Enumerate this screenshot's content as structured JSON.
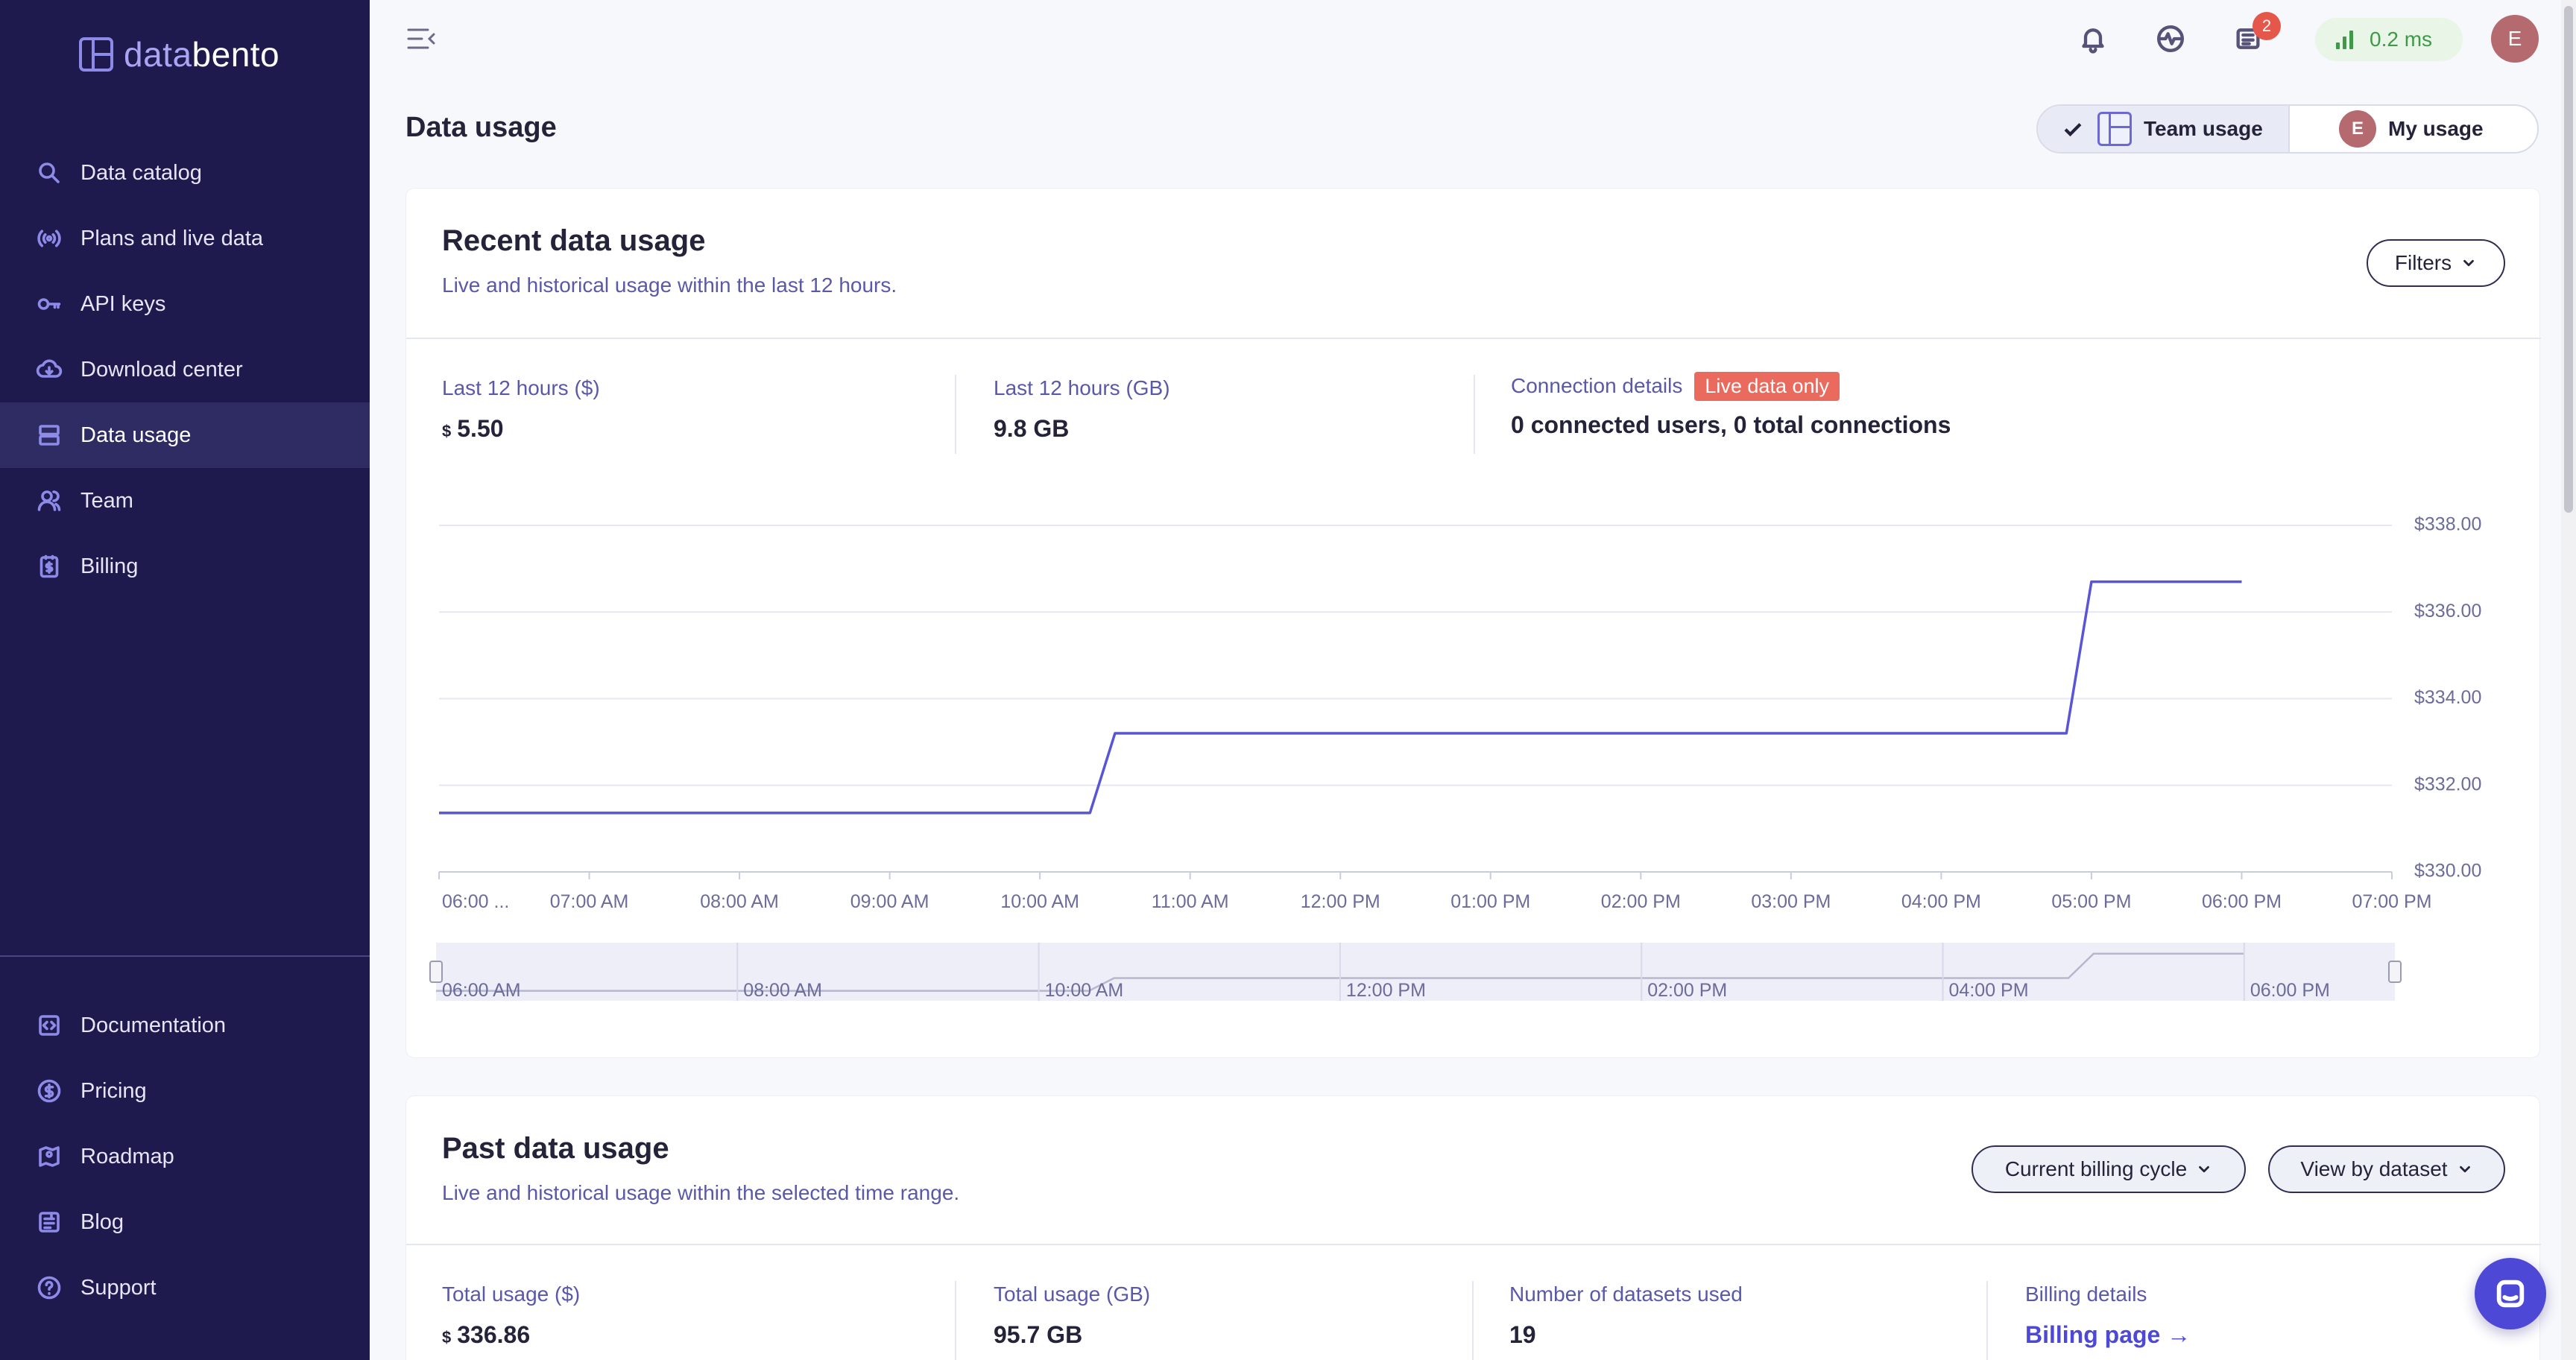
{
  "sidebar": {
    "logo": {
      "part1": "data",
      "part2": "bento"
    },
    "items": [
      {
        "label": "Data catalog",
        "icon": "search-icon"
      },
      {
        "label": "Plans and live data",
        "icon": "broadcast-icon"
      },
      {
        "label": "API keys",
        "icon": "key-icon"
      },
      {
        "label": "Download center",
        "icon": "cloud-download-icon"
      },
      {
        "label": "Data usage",
        "icon": "database-icon",
        "active": true
      },
      {
        "label": "Team",
        "icon": "team-icon"
      },
      {
        "label": "Billing",
        "icon": "receipt-dollar-icon"
      }
    ],
    "bottom_items": [
      {
        "label": "Documentation",
        "icon": "code-doc-icon"
      },
      {
        "label": "Pricing",
        "icon": "dollar-circle-icon"
      },
      {
        "label": "Roadmap",
        "icon": "map-icon"
      },
      {
        "label": "Blog",
        "icon": "blog-icon"
      },
      {
        "label": "Support",
        "icon": "help-circle-icon"
      }
    ]
  },
  "topbar": {
    "notifications_badge": "2",
    "latency": "0.2 ms",
    "avatar_initial": "E"
  },
  "header": {
    "title": "Data usage",
    "toggle": {
      "team_label": "Team usage",
      "my_label": "My usage",
      "selected": "Team usage",
      "my_avatar": "E"
    }
  },
  "recent": {
    "title": "Recent data usage",
    "subtitle": "Live and historical usage within the last 12 hours.",
    "filters_label": "Filters",
    "stats": {
      "cost_label": "Last 12 hours ($)",
      "cost_currency": "$",
      "cost_value": "5.50",
      "gb_label": "Last 12 hours (GB)",
      "gb_value": "9.8 GB",
      "conn_label": "Connection details",
      "conn_badge": "Live data only",
      "conn_value": "0 connected users, 0 total connections"
    }
  },
  "chart_data": {
    "type": "line",
    "title": "",
    "x_tick_labels": [
      "06:00 ...",
      "07:00 AM",
      "08:00 AM",
      "09:00 AM",
      "10:00 AM",
      "11:00 AM",
      "12:00 PM",
      "01:00 PM",
      "02:00 PM",
      "03:00 PM",
      "04:00 PM",
      "05:00 PM",
      "06:00 PM",
      "07:00 PM"
    ],
    "y_tick_labels": [
      "$338.00",
      "$336.00",
      "$334.00",
      "$332.00",
      "$330.00"
    ],
    "ylim": [
      330,
      338
    ],
    "x_range_hours": [
      6,
      19
    ],
    "series": [
      {
        "color": "#5855d6",
        "points": [
          {
            "x": "06:00 AM",
            "y": 331.36
          },
          {
            "x": "10:20 AM",
            "y": 331.36
          },
          {
            "x": "10:30 AM",
            "y": 333.2
          },
          {
            "x": "04:50 PM",
            "y": 333.2
          },
          {
            "x": "05:00 PM",
            "y": 336.7
          },
          {
            "x": "06:00 PM",
            "y": 336.7
          }
        ]
      }
    ],
    "navigator_tick_labels": [
      "06:00 AM",
      "08:00 AM",
      "10:00 AM",
      "12:00 PM",
      "02:00 PM",
      "04:00 PM",
      "06:00 PM"
    ],
    "grid": true
  },
  "past": {
    "title": "Past data usage",
    "subtitle": "Live and historical usage within the selected time range.",
    "range_label": "Current billing cycle",
    "view_label": "View by dataset",
    "stats": {
      "total_cost_label": "Total usage ($)",
      "total_cost_currency": "$",
      "total_cost_value": "336.86",
      "total_gb_label": "Total usage (GB)",
      "total_gb_value": "95.7 GB",
      "datasets_label": "Number of datasets used",
      "datasets_value": "19",
      "billing_label": "Billing details",
      "billing_link": "Billing page →"
    }
  }
}
